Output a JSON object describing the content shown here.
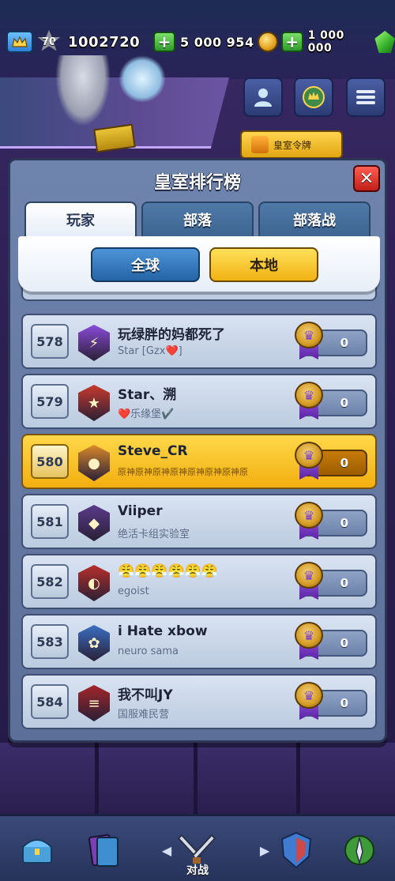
{
  "topbar": {
    "level": "70",
    "trophies": "1002720",
    "gold": "5 000 954",
    "gems": "1 000 000"
  },
  "pass_banner": {
    "label": "皇室令牌"
  },
  "panel": {
    "title": "皇室排行榜",
    "close_glyph": "✕",
    "tabs": [
      {
        "label": "玩家"
      },
      {
        "label": "部落"
      },
      {
        "label": "部落战"
      }
    ],
    "filters": {
      "global_label": "全球",
      "local_label": "本地"
    }
  },
  "rows": [
    {
      "rank": "578",
      "name": "玩绿胖的妈都死了",
      "clan": "Star [Gzx❤️]",
      "score": "0",
      "badge_color": "#8a4bd9",
      "badge_glyph": "⚡",
      "me": false
    },
    {
      "rank": "579",
      "name": "Star、溯",
      "clan": "❤️乐缘堡✔️",
      "score": "0",
      "badge_color": "#c83a2c",
      "badge_glyph": "★",
      "me": false
    },
    {
      "rank": "580",
      "name": "Steve_CR",
      "clan": "原神原神原神原神原神原神原神原",
      "score": "0",
      "badge_color": "#d9892a",
      "badge_glyph": "●",
      "me": true
    },
    {
      "rank": "581",
      "name": "Viiper",
      "clan": "绝活卡组实验室",
      "score": "0",
      "badge_color": "#5a3a8a",
      "badge_glyph": "◆",
      "me": false
    },
    {
      "rank": "582",
      "name": "😤😤😤😤😤😤",
      "clan": "egoist",
      "score": "0",
      "badge_color": "#b82f2a",
      "badge_glyph": "◐",
      "me": false
    },
    {
      "rank": "583",
      "name": "i Hate xbow",
      "clan": "neuro sama",
      "score": "0",
      "badge_color": "#3b6fc2",
      "badge_glyph": "✿",
      "me": false
    },
    {
      "rank": "584",
      "name": "我不叫JY",
      "clan": "国服难民营",
      "score": "0",
      "badge_color": "#a3252a",
      "badge_glyph": "≡",
      "me": false
    }
  ],
  "bottom_nav": {
    "battle_label": "对战",
    "items": [
      {
        "icon": "chest-icon"
      },
      {
        "icon": "cards-icon"
      },
      {
        "icon": "battle-swords-icon"
      },
      {
        "icon": "clan-shield-icon"
      },
      {
        "icon": "tournament-icon"
      }
    ]
  },
  "colors": {
    "highlight_row": "#f2af0f",
    "accent_blue": "#2463a6",
    "accent_yellow": "#f0b214",
    "close_red": "#c11f18"
  }
}
